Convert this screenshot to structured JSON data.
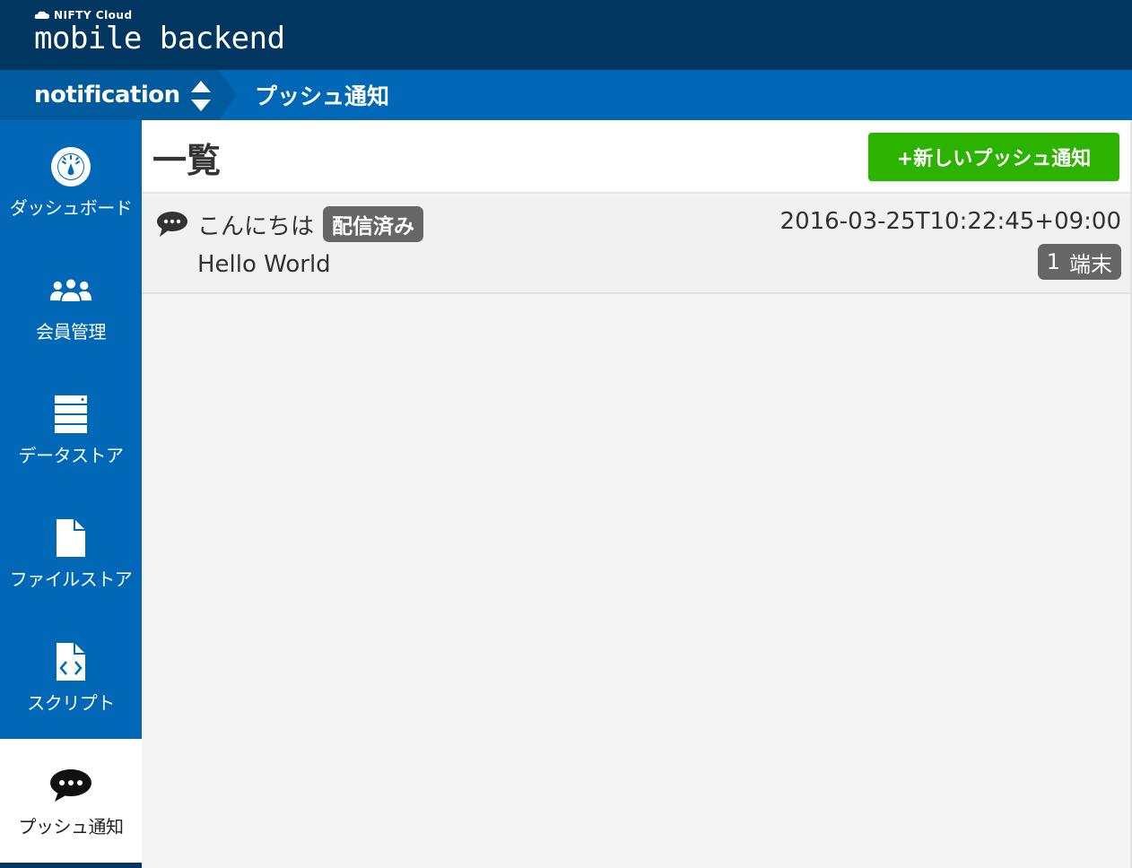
{
  "brand": {
    "small": "NIFTY Cloud",
    "big": "mobile backend"
  },
  "breadcrumb": {
    "app": "notification",
    "page": "プッシュ通知"
  },
  "sidebar": {
    "items": [
      {
        "label": "ダッシュボード",
        "icon": "dashboard-icon"
      },
      {
        "label": "会員管理",
        "icon": "users-icon"
      },
      {
        "label": "データストア",
        "icon": "datastore-icon"
      },
      {
        "label": "ファイルストア",
        "icon": "file-icon"
      },
      {
        "label": "スクリプト",
        "icon": "script-icon"
      },
      {
        "label": "プッシュ通知",
        "icon": "chat-bubble-icon",
        "active": true
      }
    ]
  },
  "main": {
    "title": "一覧",
    "new_button": "+新しいプッシュ通知",
    "notifications": [
      {
        "title": "こんにちは",
        "status": "配信済み",
        "body": "Hello World",
        "date": "2016-03-25T10:22:45+09:00",
        "count": "1",
        "count_unit": "端末"
      }
    ]
  },
  "colors": {
    "topbar": "#003660",
    "primary": "#0068b7",
    "crumb_dark": "#005a9e",
    "button_green": "#2cb300",
    "badge_gray": "#666666"
  }
}
